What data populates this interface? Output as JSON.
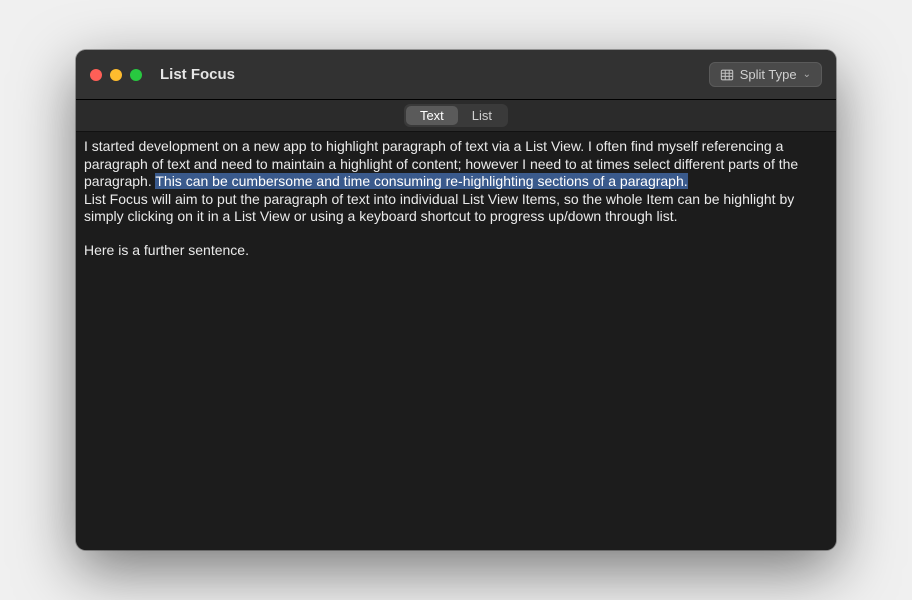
{
  "window": {
    "title": "List Focus"
  },
  "toolbar": {
    "split_type_label": "Split Type"
  },
  "tabs": {
    "text": "Text",
    "list": "List",
    "active": "text"
  },
  "content": {
    "p1_pre": "I started development on a new app to highlight paragraph of text via a List View. I often find myself referencing a paragraph of text and need to maintain a highlight of content; however I need to at times select different parts of the paragraph. ",
    "p1_sel": "This can be cumbersome and time consuming re-highlighting sections of a paragraph.",
    "p2": "List Focus will aim to put the paragraph of text into individual List View Items, so the whole Item can be highlight by simply clicking on it in a List View or using a keyboard shortcut to progress up/down through list.",
    "p3": "Here is a further sentence."
  }
}
